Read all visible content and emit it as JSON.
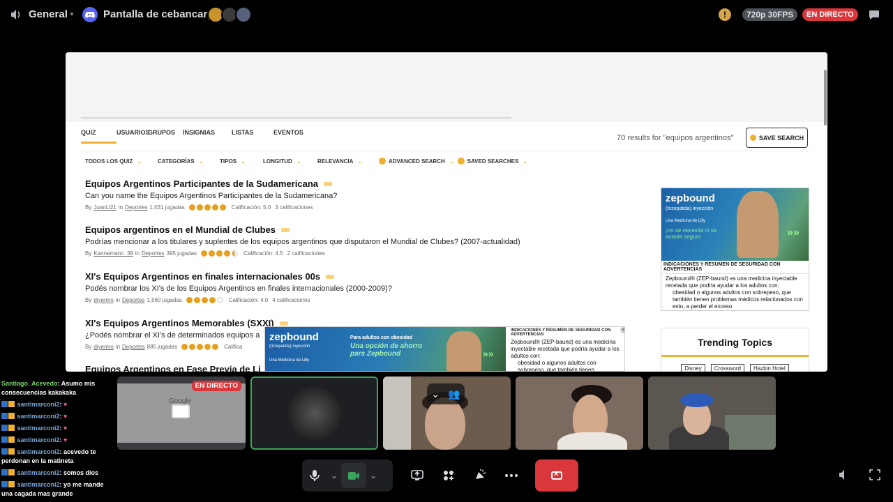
{
  "topbar": {
    "channel": "General",
    "stream_title": "Pantalla de cebancarp",
    "warning_symbol": "!",
    "quality": "720p 30FPS",
    "live": "EN DIRECTO"
  },
  "site": {
    "tabs": [
      "QUIZ",
      "USUARIOS",
      "GRUPOS",
      "INSIGNIAS",
      "LISTAS",
      "EVENTOS"
    ],
    "active_tab": "QUIZ",
    "results_text": "70 results for \"equipos argentinos\"",
    "save_search": "SAVE SEARCH",
    "filters": [
      "TODOS LOS QUIZ",
      "CATEGORÍAS",
      "TIPOS",
      "LONGITUD",
      "RELEVANCIA",
      "ADVANCED SEARCH",
      "SAVED SEARCHES"
    ],
    "quizzes": [
      {
        "title": "Equipos Argentinos Participantes de la Sudamericana",
        "desc": "Can you name the Equipos Argentinos Participantes de la Sudamericana?",
        "by": "By",
        "author": "JuanLl21",
        "in": "in",
        "category": "Deportes",
        "plays": "1,031 jugadas",
        "rating": "Calificación: 5.0",
        "rating_value": 5.0,
        "count": "3 calificaciones"
      },
      {
        "title": "Equipos argentinos en el Mundial de Clubes",
        "desc": "Podrías mencionar a los titulares y suplentes de los equipos argentinos que disputaron el Mundial de Clubes? (2007-actualidad)",
        "by": "By",
        "author": "Kannemann_39",
        "in": "in",
        "category": "Deportes",
        "plays": "395 jugadas",
        "rating": "Calificación: 4.5",
        "rating_value": 4.5,
        "count": "2 calificaciones"
      },
      {
        "title": "XI's Equipos Argentinos en finales internacionales 00s",
        "desc": "Podés nombrar los XI's de los Equipos Argentinos en finales internacionales (2000-2009)?",
        "by": "By",
        "author": "diyermo",
        "in": "in",
        "category": "Deportes",
        "plays": "1,560 jugadas",
        "rating": "Calificación: 4.0",
        "rating_value": 4.0,
        "count": "4 calificaciones"
      },
      {
        "title": "XI's Equipos Argentinos Memorables (SXXI)",
        "desc": "¿Podés nombrar el XI's de determinados equipos a",
        "by": "By",
        "author": "diyermo",
        "in": "in",
        "category": "Deportes",
        "plays": "885 jugadas",
        "rating": "Califica",
        "rating_value": 5.0,
        "count": ""
      }
    ],
    "cut_title": "Equipos Argentinos en Fase Previa de Li",
    "ad_right": {
      "brand": "zepbound",
      "sub": "(tirzepatida) inyección",
      "lilly": "Una Medicina de Lilly",
      "tagline": "¡no se necesita ni se acepta seguro",
      "arrows": "»»",
      "heading": "INDICACIONES Y RESUMEN DE SEGURIDAD CON ADVERTENCIAS",
      "body_1": "Zepbound® (ZEP-baund) es una medicina inyectable recetada que podría ayudar a los adultos con:",
      "body_2": "obesidad o algunos adultos con sobrepeso, que también tienen problemas médicos relacionados con esto, a perder el exceso"
    },
    "trending": {
      "title": "Trending Topics",
      "tags": [
        "Disney",
        "Crossword",
        "Hazbin Hotel"
      ]
    },
    "ad_bottom": {
      "brand": "zepbound",
      "sub": "(tirzepatida) inyección",
      "lilly": "Una Medicina de Lilly",
      "small": "Para adultos con obesidad",
      "offer": "Una opción de ahorro para Zepbound",
      "arrows": "»»",
      "heading": "INDICACIONES Y RESUMEN DE SEGURIDAD CON ADVERTENCIAS",
      "body_1": "Zepbound® (ZEP-baund) es una medicina inyectable recetada que podría ayudar a los adultos con:",
      "body_2": "obesidad o algunos adultos con sobrepeso, que también tienen",
      "close": "×"
    }
  },
  "chat": [
    {
      "user": "Santiago_Acevedo",
      "text": ": Asumo mis consecuencias kakakaka",
      "color": "green",
      "badges": false
    },
    {
      "user": "santimarconi2",
      "text": ": ",
      "heart": true,
      "badges": true
    },
    {
      "user": "santimarconi2",
      "text": ": ",
      "heart": true,
      "badges": true
    },
    {
      "user": "santimarconi2",
      "text": ": ",
      "heart": true,
      "badges": true
    },
    {
      "user": "santimarconi2",
      "text": ": ",
      "heart": true,
      "badges": true
    },
    {
      "user": "santimarconi2",
      "text": ": acevedo te perdonan en la matineta",
      "badges": true
    },
    {
      "user": "santimarconi2",
      "text": ": somos dios",
      "badges": true
    },
    {
      "user": "santimarconi2",
      "text": ": yo me mande una cagada mas grande",
      "badges": true
    }
  ],
  "tiles": {
    "screen_google": "Google",
    "live": "EN DIRECTO"
  },
  "colors": {
    "accent": "#f0b030",
    "live_red": "#da373c",
    "speaking_green": "#3ba55c",
    "discord_blurple": "#5865f2"
  }
}
